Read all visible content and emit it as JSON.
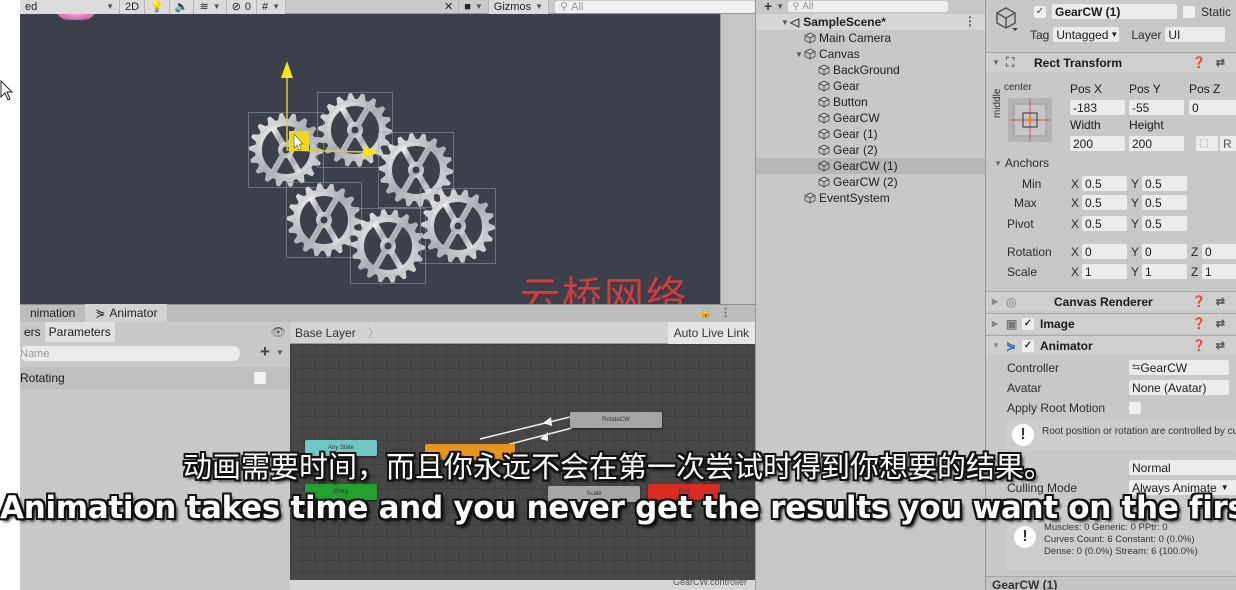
{
  "scene_toolbar": {
    "draw_mode_partial": "ed",
    "mode_2d": "2D",
    "hidden_count": "0",
    "gizmos_label": "Gizmos",
    "search_placeholder": "All"
  },
  "scene": {
    "selected_object": "GearCW (1)",
    "gear_count": 6
  },
  "watermark": "云桥网络",
  "hierarchy": {
    "search_placeholder": "All",
    "add_label": "+",
    "items": [
      {
        "label": "SampleScene*",
        "depth": 0,
        "type": "scene",
        "expanded": true
      },
      {
        "label": "Main Camera",
        "depth": 1
      },
      {
        "label": "Canvas",
        "depth": 1,
        "expanded": true
      },
      {
        "label": "BackGround",
        "depth": 2
      },
      {
        "label": "Gear",
        "depth": 2
      },
      {
        "label": "Button",
        "depth": 2
      },
      {
        "label": "GearCW",
        "depth": 2
      },
      {
        "label": "Gear (1)",
        "depth": 2
      },
      {
        "label": "Gear (2)",
        "depth": 2
      },
      {
        "label": "GearCW (1)",
        "depth": 2,
        "selected": true
      },
      {
        "label": "GearCW (2)",
        "depth": 2
      },
      {
        "label": "EventSystem",
        "depth": 1
      }
    ]
  },
  "inspector": {
    "object_name": "GearCW (1)",
    "active": true,
    "static_label": "Static",
    "tag_label": "Tag",
    "tag_value": "Untagged",
    "layer_label": "Layer",
    "layer_value": "UI",
    "rect_transform": {
      "title": "Rect Transform",
      "anchor_h": "center",
      "anchor_v": "middle",
      "pos_x_label": "Pos X",
      "pos_x": "-183",
      "pos_y_label": "Pos Y",
      "pos_y": "-55",
      "pos_z_label": "Pos Z",
      "pos_z": "0",
      "width_label": "Width",
      "width": "200",
      "height_label": "Height",
      "height": "200",
      "r_button": "R",
      "anchors_label": "Anchors",
      "min_label": "Min",
      "min_x": "0.5",
      "min_y": "0.5",
      "max_label": "Max",
      "max_x": "0.5",
      "max_y": "0.5",
      "pivot_label": "Pivot",
      "pivot_x": "0.5",
      "pivot_y": "0.5",
      "rotation_label": "Rotation",
      "rot_x": "0",
      "rot_y": "0",
      "rot_z": "0",
      "scale_label": "Scale",
      "scale_x": "1",
      "scale_y": "1",
      "scale_z": "1",
      "x": "X",
      "y": "Y",
      "z": "Z"
    },
    "canvas_renderer": {
      "title": "Canvas Renderer"
    },
    "image": {
      "title": "Image",
      "enabled": true
    },
    "animator": {
      "title": "Animator",
      "enabled": true,
      "controller_label": "Controller",
      "controller_value": "GearCW",
      "avatar_label": "Avatar",
      "avatar_value": "None (Avatar)",
      "apply_root_motion_label": "Apply Root Motion",
      "apply_root_motion": false,
      "root_warning": "Root position or rotation are controlled by curves",
      "update_mode_value": "Normal",
      "culling_mode_label": "Culling Mode",
      "culling_mode_value": "Always Animate",
      "clip_info_partial": "1",
      "stats_line1": "Muscles: 0 Generic: 0 PPtr: 0",
      "stats_line2": "Curves Count: 6 Constant: 0 (0.0%)",
      "stats_line3": "Dense: 0 (0.0%) Stream: 6 (100.0%)"
    },
    "footer_label": "GearCW (1)"
  },
  "animator_window": {
    "tabs": [
      {
        "label": "nimation",
        "active": false
      },
      {
        "label": "Animator",
        "active": true
      }
    ],
    "left_tabs": [
      {
        "label": "ers",
        "active": false
      },
      {
        "label": "Parameters",
        "active": true
      }
    ],
    "param_search_placeholder": "Name",
    "add_label": "+",
    "parameters": [
      {
        "name": "Rotating",
        "type": "bool",
        "value": false
      }
    ],
    "breadcrumb": "Base Layer",
    "auto_live_link": "Auto Live Link",
    "states": [
      {
        "name": "Any State",
        "kind": "any",
        "color": "#6fc7c2"
      },
      {
        "name": "Entry",
        "kind": "entry",
        "color": "#23a02f"
      },
      {
        "name": "",
        "kind": "default",
        "color": "#e6961f"
      },
      {
        "name": "RotateCW",
        "kind": "normal",
        "color": "#a6a6a6"
      },
      {
        "name": "Scale",
        "kind": "normal",
        "color": "#a6a6a6"
      },
      {
        "name": "Exit",
        "kind": "exit",
        "color": "#d82b22"
      }
    ],
    "footer_text": "GearCW.controller"
  },
  "subtitles": {
    "chinese": "动画需要时间，而且你永远不会在第一次尝试时得到你想要的结果。",
    "english": "Animation takes time and you never get the results you want on the first try."
  }
}
